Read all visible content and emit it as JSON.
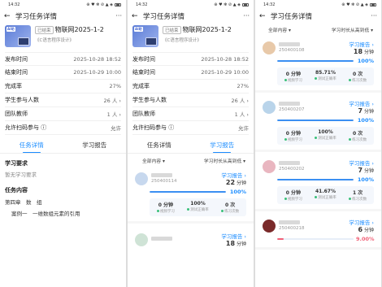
{
  "status": {
    "time": "14:32",
    "icons": "⊕ ♥ ✻ ⊘ ▲ ◈"
  },
  "header": {
    "back": "←",
    "title": "学习任务详情",
    "more": "···"
  },
  "task": {
    "thumb_badge": "AI助",
    "tag": "已结束",
    "name": "物联网2025-1-2",
    "course": "《C语言程序设计》"
  },
  "rows": [
    {
      "label": "发布时间",
      "value": "2025-10-28 18:52"
    },
    {
      "label": "结束时间",
      "value": "2025-10-29 10:00"
    },
    {
      "label": "完成率",
      "value": "27%"
    },
    {
      "label": "学生参与人数",
      "value": "26 人 ›"
    },
    {
      "label": "团队教师",
      "value": "1 人 ›"
    },
    {
      "label": "允许扫码参与",
      "value": "允许"
    }
  ],
  "tabs": {
    "detail": "任务详情",
    "report": "学习报告"
  },
  "detail": {
    "req_title": "学习要求",
    "req_text": "暂无学习要求",
    "content_title": "任务内容",
    "content_chapter": "第四章　数　组",
    "content_case": "案例一　一维数组元素的引用"
  },
  "filters": {
    "all": "全部内容 ▾",
    "sort": "学习时长从高到低 ▾"
  },
  "report_labels": {
    "link": "学习报告 ›",
    "unit": "分钟",
    "video": "视频学习",
    "test": "测试正确率",
    "practice": "练习次数"
  },
  "cards_s2": [
    {
      "id": "250400114",
      "minutes": "22",
      "progress_text": "100%",
      "progress": 1.0,
      "stats": [
        "0 分钟",
        "100%",
        "0 次"
      ],
      "avatar": "#c7d8ee",
      "red": false
    }
  ],
  "cards_s2_partial_minutes": "18",
  "cards_s3": [
    {
      "id": "250400108",
      "minutes": "18",
      "progress_text": "100%",
      "progress": 1.0,
      "stats": [
        "0 分钟",
        "85.71%",
        "0 次"
      ],
      "avatar": "#e8c9a9",
      "red": false
    },
    {
      "id": "250400207",
      "minutes": "7",
      "progress_text": "100%",
      "progress": 1.0,
      "stats": [
        "0 分钟",
        "100%",
        "0 次"
      ],
      "avatar": "#b9d4ea",
      "red": false
    },
    {
      "id": "250400202",
      "minutes": "7",
      "progress_text": "100%",
      "progress": 1.0,
      "stats": [
        "0 分钟",
        "41.67%",
        "1 次"
      ],
      "avatar": "#e9b6c0",
      "red": false
    },
    {
      "id": "250400218",
      "minutes": "6",
      "progress_text": "9.00%",
      "progress": 0.09,
      "stats": [],
      "avatar": "#7a2a2a",
      "red": true
    }
  ],
  "colors": {
    "accent": "#1a8cff",
    "progress": "#3b8ff2",
    "warn": "#f06076"
  }
}
